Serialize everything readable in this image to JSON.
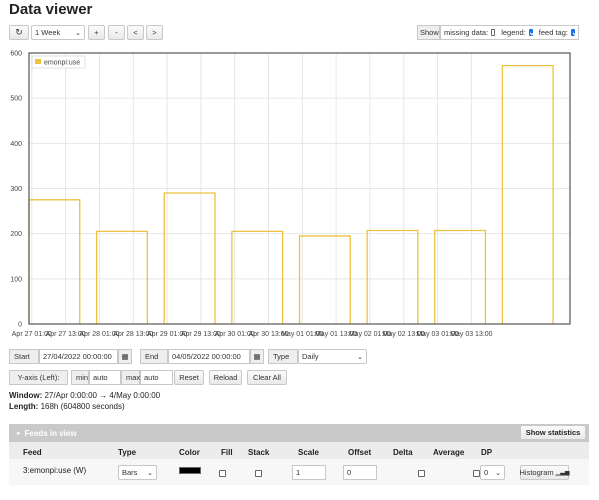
{
  "page": {
    "title": "Data viewer"
  },
  "toolbar": {
    "refresh_glyph": "↻",
    "range_select": "1 Week",
    "zoom_in": "+",
    "zoom_out": "-",
    "pan_left": "<",
    "pan_right": ">",
    "show_label": "Show",
    "missing_data_label": "missing data:",
    "missing_data_checked": false,
    "legend_label": "legend:",
    "legend_checked": true,
    "feed_tag_label": "feed tag:",
    "feed_tag_checked": true
  },
  "chart_data": {
    "type": "bar",
    "title": "",
    "xlabel": "",
    "ylabel": "",
    "ylim": [
      0,
      600
    ],
    "y_ticks": [
      "0",
      "100",
      "200",
      "300",
      "400",
      "500",
      "600"
    ],
    "x_tick_labels": [
      "Apr 27 01:00",
      "Apr 27 13:00",
      "Apr 28 01:00",
      "Apr 28 13:00",
      "Apr 29 01:00",
      "Apr 29 13:00",
      "Apr 30 01:00",
      "Apr 30 13:00",
      "May 01 01:00",
      "May 01 13:00",
      "May 02 01:00",
      "May 02 13:00",
      "May 03 01:00",
      "May 03 13:00"
    ],
    "legend": [
      "emonpi:use"
    ],
    "legend_position": "top-left",
    "grid": true,
    "series": [
      {
        "name": "emonpi:use",
        "color": "#edc240",
        "categories": [
          "27/04/2022",
          "28/04/2022",
          "29/04/2022",
          "30/04/2022",
          "01/05/2022",
          "02/05/2022",
          "03/05/2022",
          "04/05/2022"
        ],
        "values": [
          275,
          205,
          290,
          205,
          195,
          207,
          207,
          572
        ]
      }
    ]
  },
  "controls": {
    "start_label": "Start",
    "start_value": "27/04/2022 00:00:00",
    "end_label": "End",
    "end_value": "04/05/2022 00:00:00",
    "type_label": "Type",
    "type_value": "Daily",
    "yaxis_label": "Y-axis (Left):",
    "min_label": "min",
    "min_value": "auto",
    "max_label": "max",
    "max_value": "auto",
    "reset_label": "Reset",
    "reload_label": "Reload",
    "clear_all_label": "Clear All",
    "calendar_glyph": "▦"
  },
  "info": {
    "window_label": "Window:",
    "window_value": "27/Apr 0:00:00 → 4/May 0:00:00",
    "length_label": "Length:",
    "length_value": "168h (604800 seconds)"
  },
  "feeds": {
    "panel_title": "Feeds in view",
    "show_statistics": "Show statistics",
    "columns": [
      "Feed",
      "Type",
      "Color",
      "Fill",
      "Stack",
      "Scale",
      "Offset",
      "Delta",
      "Average",
      "DP"
    ],
    "rows": [
      {
        "feed": "3:emonpi:use (W)",
        "type": "Bars",
        "color": "#000000",
        "fill": false,
        "stack": false,
        "scale": "1",
        "offset": "0",
        "delta": false,
        "average": false,
        "dp": "0",
        "histogram": "Histogram"
      }
    ]
  }
}
